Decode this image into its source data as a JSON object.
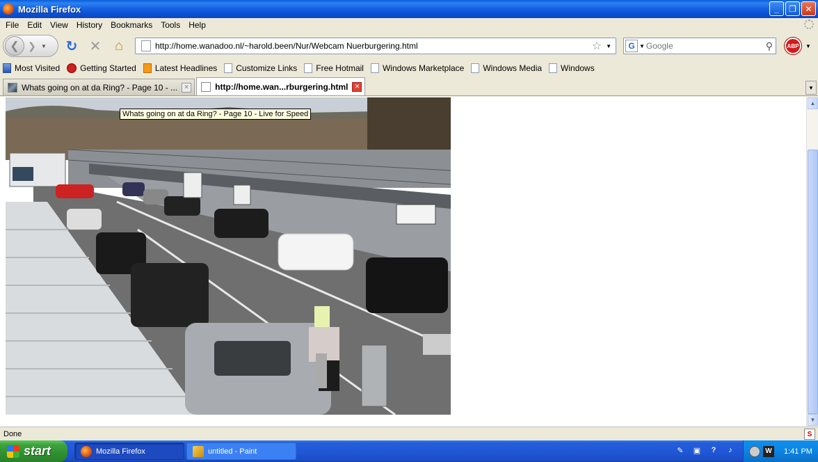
{
  "window": {
    "title": "Mozilla Firefox",
    "buttons": {
      "minimize": "_",
      "maximize": "❐",
      "close": "✕"
    }
  },
  "menu": [
    "File",
    "Edit",
    "View",
    "History",
    "Bookmarks",
    "Tools",
    "Help"
  ],
  "nav": {
    "url": "http://home.wanadoo.nl/~harold.been/Nur/Webcam Nuerburgering.html",
    "search_placeholder": "Google",
    "abp_label": "ABP"
  },
  "bookmarks": [
    {
      "label": "Most Visited",
      "icon": "most-visited-icon"
    },
    {
      "label": "Getting Started",
      "icon": "getting-started-icon"
    },
    {
      "label": "Latest Headlines",
      "icon": "rss-icon"
    },
    {
      "label": "Customize Links",
      "icon": "page-icon"
    },
    {
      "label": "Free Hotmail",
      "icon": "page-icon"
    },
    {
      "label": "Windows Marketplace",
      "icon": "page-icon"
    },
    {
      "label": "Windows Media",
      "icon": "page-icon"
    },
    {
      "label": "Windows",
      "icon": "page-icon"
    }
  ],
  "tabs": [
    {
      "label": "Whats going on at da Ring? - Page 10 - ...",
      "active": false
    },
    {
      "label": "http://home.wan...rburgering.html",
      "active": true
    }
  ],
  "content": {
    "tooltip": "Whats going on at da Ring? - Page 10 - Live for Speed"
  },
  "status": {
    "text": "Done",
    "icon_label": "S"
  },
  "taskbar": {
    "start": "start",
    "tasks": [
      {
        "label": "Mozilla Firefox",
        "active": true
      },
      {
        "label": "untitled - Paint",
        "active": false
      }
    ],
    "clock": "1:41 PM"
  }
}
